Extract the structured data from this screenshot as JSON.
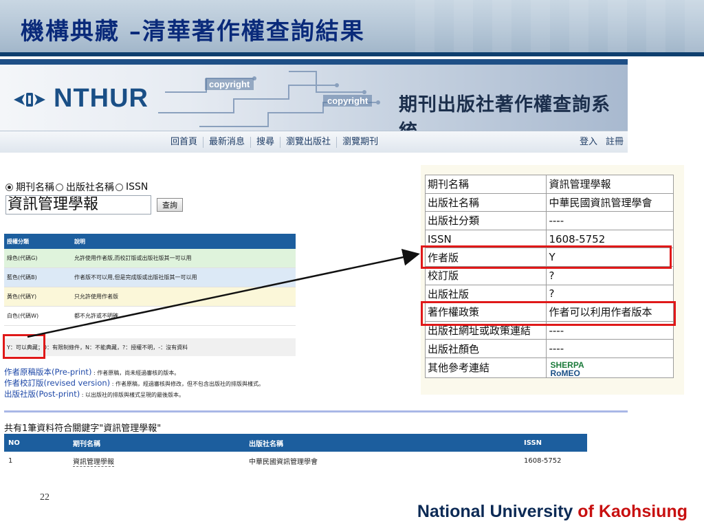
{
  "slide": {
    "title": "機構典藏 –清華著作權查詢結果",
    "page_number": "22",
    "footer_main": "National University ",
    "footer_accent": "of Kaohsiung",
    "colors": {
      "title": "#0a2a7a",
      "header_blue": "#1c5e9e",
      "highlight_red": "#e01818",
      "footer_red": "#c81010"
    }
  },
  "site_header": {
    "logo": "NTHUR",
    "copyright_tag_1": "copyright",
    "copyright_tag_2": "copyright",
    "system_title": "期刊出版社著作權查詢系統",
    "nav": [
      "回首頁",
      "最新消息",
      "搜尋",
      "瀏覽出版社",
      "瀏覽期刊"
    ],
    "nav_right": [
      "登入",
      "註冊"
    ]
  },
  "search": {
    "options": [
      "期刊名稱",
      "出版社名稱",
      "ISSN"
    ],
    "selected": "期刊名稱",
    "query": "資訊管理學報",
    "button": "查詢"
  },
  "legend": {
    "headers": [
      "授權分類",
      "說明"
    ],
    "rows": [
      {
        "color": "綠色(代碼G)",
        "desc": "允許使用作者版,而校訂版或出版社版其一可以用"
      },
      {
        "color": "藍色(代碼B)",
        "desc": "作者版不可以用,但是完成版或出版社版其一可以用"
      },
      {
        "color": "黃色(代碼Y)",
        "desc": "只允許使用作者版"
      },
      {
        "color": "白色(代碼W)",
        "desc": "都不允許或不明確"
      }
    ],
    "code_note_y": "Y：可以典藏",
    "code_note_rest": "；0：有限制條件，N：不能典藏，?：授權不明，-：沒有資料"
  },
  "versions": [
    {
      "label": "作者原稿版本(Pre-print)",
      "desc": " : 作者原稿，尚未經過審核的版本。"
    },
    {
      "label": "作者校訂版(revised version)",
      "desc": " : 作者原稿，經過審核與修改，但不包含出版社的排版與樣式。"
    },
    {
      "label": "出版社版(Post-print)",
      "desc": " : 以出版社的排版與樣式呈現的最後版本。"
    }
  ],
  "results": {
    "summary": "共有1筆資料符合關鍵字\"資訊管理學報\"",
    "headers": [
      "NO",
      "期刊名稱",
      "出版社名稱",
      "ISSN"
    ],
    "rows": [
      {
        "no": "1",
        "title": "資訊管理學報",
        "publisher": "中華民國資訊管理學會",
        "issn": "1608-5752"
      }
    ]
  },
  "detail": {
    "rows": [
      {
        "k": "期刊名稱",
        "v": "資訊管理學報"
      },
      {
        "k": "出版社名稱",
        "v": "中華民國資訊管理學會"
      },
      {
        "k": "出版社分類",
        "v": "----"
      },
      {
        "k": "ISSN",
        "v": "1608-5752"
      },
      {
        "k": "作者版",
        "v": "Y"
      },
      {
        "k": "校訂版",
        "v": "?"
      },
      {
        "k": "出版社版",
        "v": "?"
      },
      {
        "k": "著作權政策",
        "v": "作者可以利用作者版本"
      },
      {
        "k": "出版社網址或政策連結",
        "v": "----"
      },
      {
        "k": "出版社顏色",
        "v": "----"
      },
      {
        "k": "其他參考連結",
        "v": ""
      }
    ],
    "romeo_top": "SHERPA",
    "romeo_bottom": "RoMEO"
  }
}
